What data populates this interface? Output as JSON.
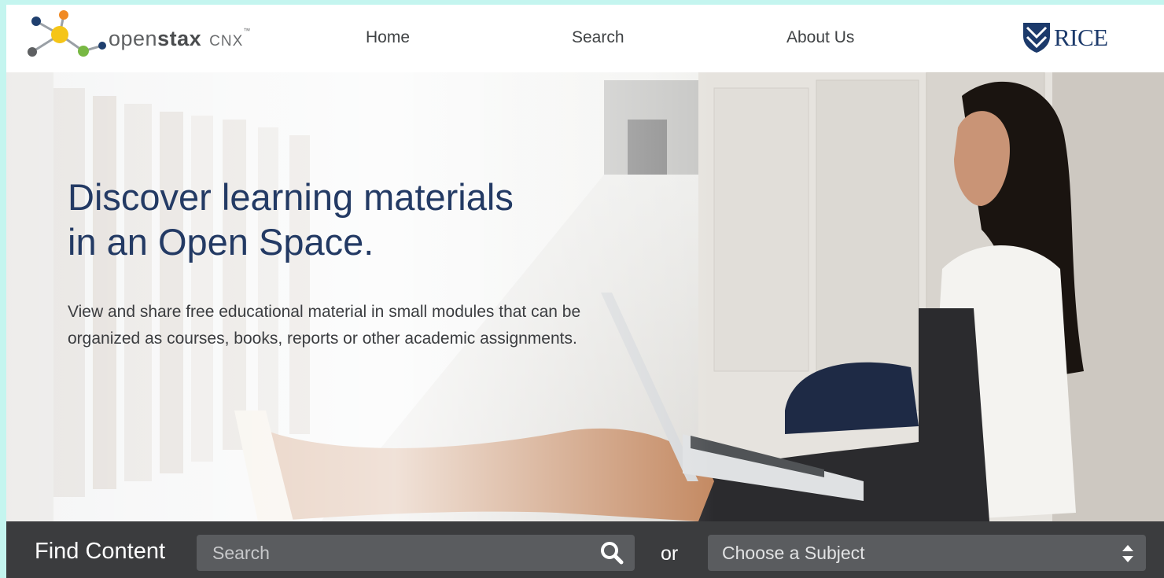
{
  "header": {
    "brand_name_light": "open",
    "brand_name_bold": "stax",
    "brand_product": "CNX",
    "brand_tm": "™",
    "nav": [
      {
        "label": "Home"
      },
      {
        "label": "Search"
      },
      {
        "label": "About Us"
      }
    ],
    "partner_logo_text": "RICE",
    "partner_logo_icon": "shield-icon"
  },
  "hero": {
    "headline_line1": "Discover learning materials",
    "headline_line2": "in an Open Space.",
    "description": "View and share free educational material in small modules that can be organized as courses, books, reports or other academic assignments."
  },
  "find_bar": {
    "label": "Find Content",
    "search_placeholder": "Search",
    "search_icon": "search-icon",
    "or_label": "or",
    "subject_selected": "Choose a Subject",
    "subject_icon": "sort-arrows-icon"
  },
  "colors": {
    "headline": "#233a64",
    "find_bar_bg": "#3b3c3e",
    "input_bg": "#5a5c5f",
    "logo_yellow": "#f5c518",
    "logo_orange": "#f08a24",
    "logo_green": "#78b843",
    "logo_navy": "#1f3f6e",
    "logo_gray": "#5e6062"
  }
}
